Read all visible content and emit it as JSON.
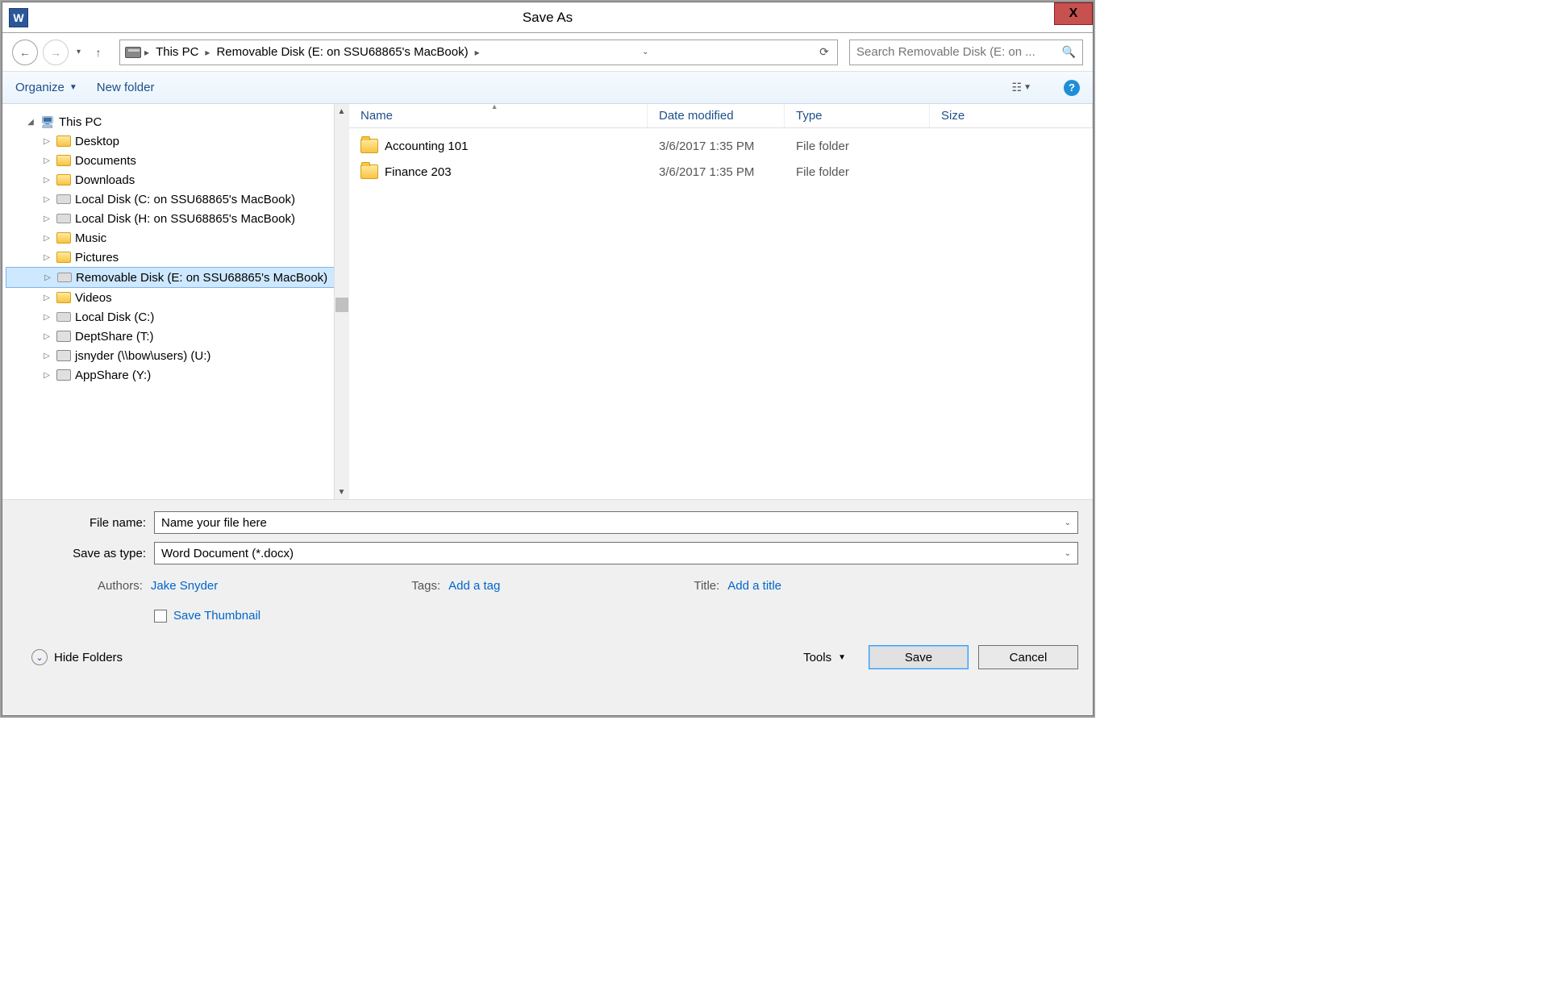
{
  "titlebar": {
    "title": "Save As",
    "app_letter": "W",
    "close": "X"
  },
  "nav": {
    "breadcrumbs": [
      "This PC",
      "Removable Disk (E: on SSU68865's MacBook)"
    ],
    "search_placeholder": "Search Removable Disk (E: on ..."
  },
  "toolbar": {
    "organize": "Organize",
    "new_folder": "New folder"
  },
  "tree": {
    "root": "This PC",
    "items": [
      {
        "label": "Desktop",
        "icon": "folder"
      },
      {
        "label": "Documents",
        "icon": "folder"
      },
      {
        "label": "Downloads",
        "icon": "folder"
      },
      {
        "label": "Local Disk (C: on SSU68865's MacBook)",
        "icon": "disk"
      },
      {
        "label": "Local Disk (H: on SSU68865's MacBook)",
        "icon": "disk"
      },
      {
        "label": "Music",
        "icon": "folder"
      },
      {
        "label": "Pictures",
        "icon": "folder"
      },
      {
        "label": "Removable Disk (E: on SSU68865's MacBook)",
        "icon": "disk",
        "selected": true
      },
      {
        "label": "Videos",
        "icon": "folder"
      },
      {
        "label": "Local Disk (C:)",
        "icon": "disk"
      },
      {
        "label": "DeptShare (T:)",
        "icon": "net"
      },
      {
        "label": "jsnyder (\\\\bow\\users) (U:)",
        "icon": "net"
      },
      {
        "label": "AppShare (Y:)",
        "icon": "net"
      }
    ]
  },
  "columns": {
    "name": "Name",
    "date": "Date modified",
    "type": "Type",
    "size": "Size"
  },
  "files": [
    {
      "name": "Accounting 101",
      "date": "3/6/2017 1:35 PM",
      "type": "File folder"
    },
    {
      "name": "Finance 203",
      "date": "3/6/2017 1:35 PM",
      "type": "File folder"
    }
  ],
  "fields": {
    "filename_label": "File name:",
    "filename_value": "Name your file here",
    "saveas_label": "Save as type:",
    "saveas_value": "Word Document (*.docx)"
  },
  "meta": {
    "authors_label": "Authors:",
    "authors_value": "Jake Snyder",
    "tags_label": "Tags:",
    "tags_value": "Add a tag",
    "title_label": "Title:",
    "title_value": "Add a title"
  },
  "thumbnail_label": "Save Thumbnail",
  "footer": {
    "hide_folders": "Hide Folders",
    "tools": "Tools",
    "save": "Save",
    "cancel": "Cancel"
  }
}
